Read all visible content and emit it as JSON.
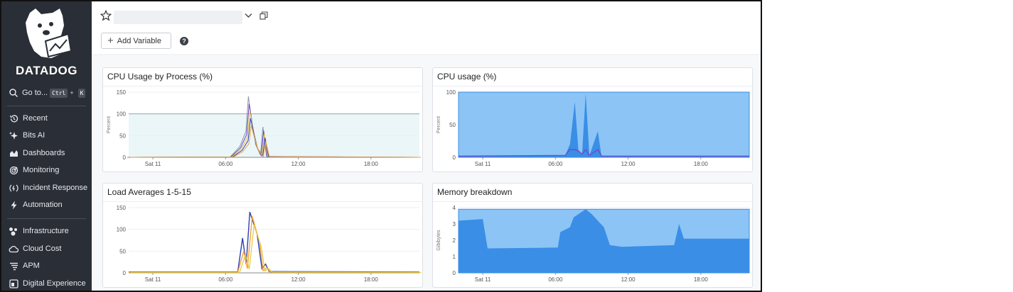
{
  "sidebar": {
    "brand": "DATADOG",
    "goto": {
      "label": "Go to...",
      "key1": "Ctrl",
      "plus": "+",
      "key2": "K"
    },
    "items": [
      {
        "label": "Recent",
        "icon": "history-icon"
      },
      {
        "label": "Bits AI",
        "icon": "sparkle-icon"
      },
      {
        "label": "Dashboards",
        "icon": "dashboard-icon"
      },
      {
        "label": "Monitoring",
        "icon": "monitoring-icon"
      },
      {
        "label": "Incident Response",
        "icon": "incident-icon"
      },
      {
        "label": "Automation",
        "icon": "bolt-icon"
      },
      {
        "label": "Infrastructure",
        "icon": "infrastructure-icon"
      },
      {
        "label": "Cloud Cost",
        "icon": "cloud-icon"
      },
      {
        "label": "APM",
        "icon": "apm-icon"
      },
      {
        "label": "Digital Experience",
        "icon": "digital-experience-icon"
      }
    ]
  },
  "header": {
    "add_variable": "Add Variable",
    "help": "?"
  },
  "colors": {
    "sidebar_bg": "#2a2e36",
    "blue_fill": "#8cc4f5",
    "blue_dark": "#3a8ee6",
    "line_blue": "#2c3fb6",
    "line_orange": "#f0a33a",
    "line_yellow": "#e8c93a",
    "line_purple": "#7a3fc7"
  },
  "widgets": {
    "cpu_process": {
      "title": "CPU Usage by Process (%)",
      "ylabel": "Percent",
      "yticks": [
        "150",
        "100",
        "50",
        "0"
      ],
      "xticks": [
        "Sat 11",
        "06:00",
        "12:00",
        "18:00"
      ]
    },
    "cpu_usage": {
      "title": "CPU usage (%)",
      "ylabel": "Percent",
      "yticks": [
        "100",
        "50",
        "0"
      ],
      "xticks": [
        "Sat 11",
        "06:00",
        "12:00",
        "18:00"
      ]
    },
    "load_avg": {
      "title": "Load Averages 1-5-15",
      "ylabel": "",
      "yticks": [
        "150",
        "100",
        "50",
        "0"
      ],
      "xticks": [
        "Sat 11",
        "06:00",
        "12:00",
        "18:00"
      ]
    },
    "memory": {
      "title": "Memory breakdown",
      "ylabel": "Gibibytes",
      "yticks": [
        "4",
        "3",
        "2",
        "1",
        "0"
      ],
      "xticks": [
        "Sat 11",
        "06:00",
        "12:00",
        "18:00"
      ]
    }
  },
  "chart_data": [
    {
      "type": "line",
      "title": "CPU Usage by Process (%)",
      "ylabel": "Percent",
      "ylim": [
        0,
        150
      ],
      "x": [
        "Sat 11",
        "06:00",
        "12:00",
        "18:00"
      ],
      "series_shape": "spikes",
      "values": [
        [
          0,
          0
        ],
        [
          8.5,
          1
        ],
        [
          9.3,
          25
        ],
        [
          9.8,
          60
        ],
        [
          10.0,
          140
        ],
        [
          10.3,
          80
        ],
        [
          10.6,
          30
        ],
        [
          11.0,
          5
        ],
        [
          11.2,
          70
        ],
        [
          11.5,
          2
        ],
        [
          24,
          0
        ]
      ]
    },
    {
      "type": "area",
      "title": "CPU usage (%)",
      "ylabel": "Percent",
      "ylim": [
        0,
        100
      ],
      "x": [
        "Sat 11",
        "06:00",
        "12:00",
        "18:00"
      ],
      "values": [
        [
          0,
          100
        ],
        [
          24,
          100
        ]
      ],
      "secondary": [
        [
          0,
          2
        ],
        [
          8.8,
          3
        ],
        [
          9.2,
          20
        ],
        [
          9.6,
          85
        ],
        [
          9.9,
          10
        ],
        [
          10.2,
          5
        ],
        [
          10.5,
          98
        ],
        [
          10.8,
          3
        ],
        [
          11.5,
          40
        ],
        [
          11.8,
          2
        ],
        [
          24,
          2
        ]
      ]
    },
    {
      "type": "line",
      "title": "Load Averages 1-5-15",
      "ylim": [
        0,
        150
      ],
      "x": [
        "Sat 11",
        "06:00",
        "12:00",
        "18:00"
      ],
      "series": [
        {
          "values": [
            [
              0,
              2
            ],
            [
              9.0,
              2
            ],
            [
              9.4,
              80
            ],
            [
              9.7,
              20
            ],
            [
              10.0,
              140
            ],
            [
              10.6,
              90
            ],
            [
              11.0,
              10
            ],
            [
              11.3,
              20
            ],
            [
              11.6,
              3
            ],
            [
              24,
              2
            ]
          ]
        },
        {
          "values": [
            [
              0,
              1
            ],
            [
              9.0,
              1
            ],
            [
              9.5,
              50
            ],
            [
              9.8,
              10
            ],
            [
              10.2,
              130
            ],
            [
              10.8,
              70
            ],
            [
              11.1,
              5
            ],
            [
              11.4,
              12
            ],
            [
              11.7,
              2
            ],
            [
              24,
              1
            ]
          ]
        }
      ]
    },
    {
      "type": "area",
      "title": "Memory breakdown",
      "ylabel": "Gibibytes",
      "ylim": [
        0,
        4
      ],
      "x": [
        "Sat 11",
        "06:00",
        "12:00",
        "18:00"
      ],
      "values": [
        [
          0,
          3.9
        ],
        [
          24,
          3.9
        ]
      ],
      "secondary": [
        [
          0,
          3.2
        ],
        [
          2,
          3.3
        ],
        [
          2.4,
          1.5
        ],
        [
          8.2,
          1.55
        ],
        [
          8.4,
          2.5
        ],
        [
          9.2,
          2.8
        ],
        [
          9.5,
          3.4
        ],
        [
          10.5,
          3.9
        ],
        [
          11.0,
          3.6
        ],
        [
          12.0,
          2.8
        ],
        [
          12.5,
          1.7
        ],
        [
          13.5,
          1.6
        ],
        [
          17.8,
          1.7
        ],
        [
          18.2,
          3.0
        ],
        [
          18.6,
          2.1
        ],
        [
          24,
          2.1
        ]
      ]
    }
  ]
}
